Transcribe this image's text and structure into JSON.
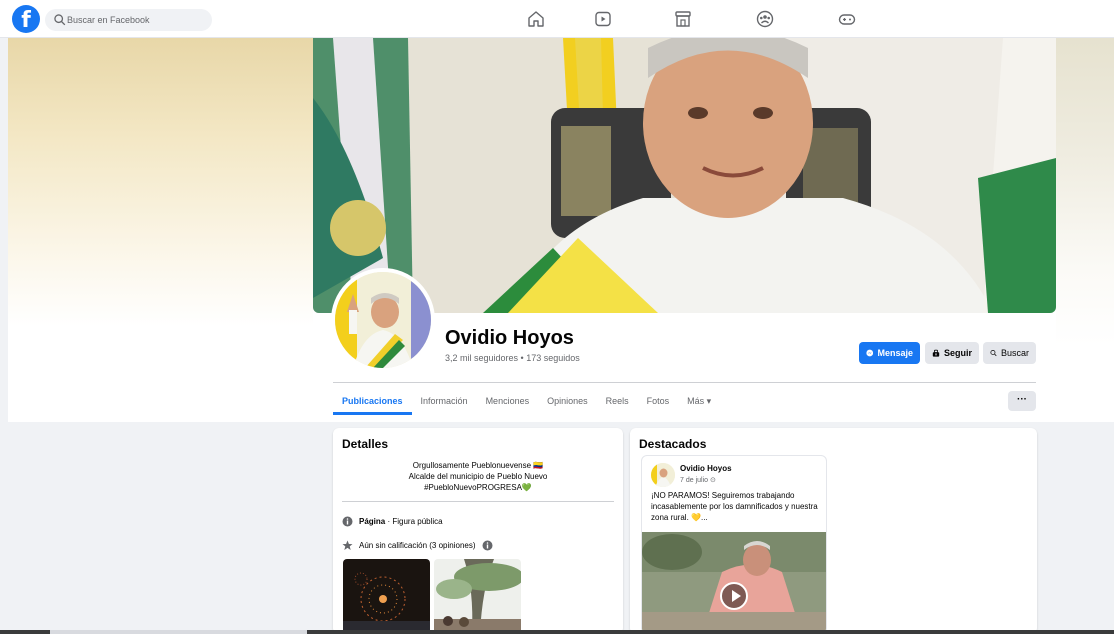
{
  "topbar": {
    "logo": "facebook-logo",
    "search_placeholder": "Buscar en Facebook",
    "nav": [
      "home-icon",
      "video-icon",
      "marketplace-icon",
      "groups-icon",
      "gaming-icon"
    ]
  },
  "profile": {
    "name": "Ovidio Hoyos",
    "stats": "3,2 mil seguidores • 173 seguidos"
  },
  "actions": {
    "message": "Mensaje",
    "follow": "Seguir",
    "search": "Buscar"
  },
  "tabs": [
    "Publicaciones",
    "Información",
    "Menciones",
    "Opiniones",
    "Reels",
    "Fotos",
    "Más ▾"
  ],
  "details": {
    "title": "Detalles",
    "bio": [
      "Orgullosamente Pueblonuevense 🇨🇴",
      "Alcalde del municipio de Pueblo Nuevo",
      "#PuebloNuevoPROGRESA💚"
    ],
    "page_label": "Página",
    "page_category": " · Figura pública",
    "rating": "Aún sin calificación (3 opiniones)"
  },
  "featured": {
    "title": "Destacados",
    "post": {
      "author": "Ovidio Hoyos",
      "date": "7 de julio",
      "text": "¡NO PARAMOS! Seguiremos trabajando incasablemente por los damnificados y nuestra zona rural. 💛..."
    }
  },
  "colors": {
    "brand": "#1877f2",
    "background": "#f0f2f5",
    "secondary_text": "#65676b"
  }
}
